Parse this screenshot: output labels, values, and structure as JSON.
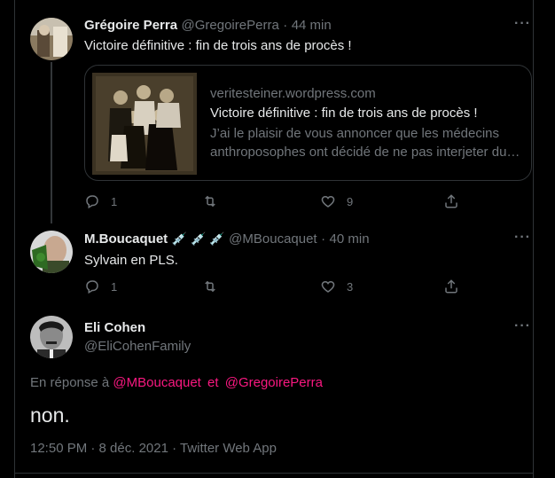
{
  "tweet1": {
    "name": "Grégoire Perra",
    "handle": "@GregoirePerra",
    "time": "44 min",
    "text": "Victoire définitive : fin de trois ans de procès !",
    "card": {
      "domain": "veritesteiner.wordpress.com",
      "title": "Victoire définitive : fin de trois ans de procès !",
      "description": "J’ai le plaisir de vous annoncer que les médecins anthroposophes ont décidé de ne pas interjeter du…"
    },
    "replies": "1",
    "retweets": "",
    "likes": "9"
  },
  "tweet2": {
    "name": "M.Boucaquet",
    "name_emoji": "💉 💉 💉",
    "handle": "@MBoucaquet",
    "time": "40 min",
    "text": "Sylvain en PLS.",
    "replies": "1",
    "retweets": "",
    "likes": "3"
  },
  "main": {
    "name": "Eli Cohen",
    "handle": "@EliCohenFamily",
    "replying_prefix": "En réponse à",
    "mention1": "@MBoucaquet",
    "conj": "et",
    "mention2": "@GregoirePerra",
    "text": "non.",
    "meta": "12:50 PM · 8 déc. 2021 · Twitter Web App"
  },
  "ui": {
    "dot": "·",
    "more": "···"
  }
}
